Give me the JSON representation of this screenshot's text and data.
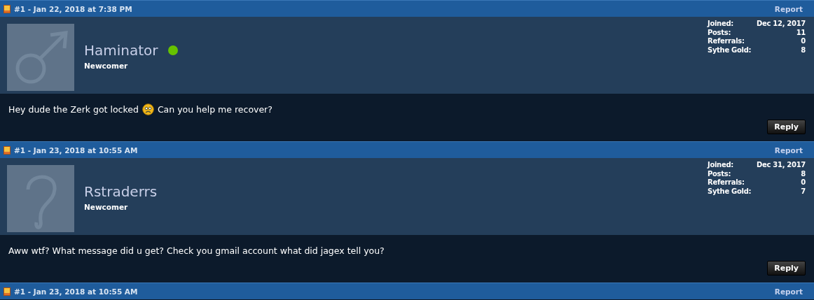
{
  "posts": [
    {
      "header": "#1 - Jan 22, 2018 at 7:38 PM",
      "report": "Report",
      "user": {
        "name": "Haminator",
        "online": true,
        "rank": "Newcomer",
        "avatar": {
          "kind": "male"
        }
      },
      "stats": [
        {
          "label": "Joined:",
          "value": "Dec 12, 2017"
        },
        {
          "label": "Posts:",
          "value": "11"
        },
        {
          "label": "Referrals:",
          "value": "0"
        },
        {
          "label": "Sythe Gold:",
          "value": "8"
        }
      ],
      "message": [
        "Hey dude the Zerk got locked",
        "Can you help me recover?"
      ],
      "reply": "Reply"
    },
    {
      "header": "#1 - Jan 23, 2018 at 10:55 AM",
      "report": "Report",
      "user": {
        "name": "Rstraderrs",
        "online": false,
        "rank": "Newcomer",
        "avatar": {
          "kind": "question"
        }
      },
      "stats": [
        {
          "label": "Joined:",
          "value": "Dec 31, 2017"
        },
        {
          "label": "Posts:",
          "value": "8"
        },
        {
          "label": "Referrals:",
          "value": "0"
        },
        {
          "label": "Sythe Gold:",
          "value": "7"
        }
      ],
      "message": [
        "Aww wtf? What message did u get? Check you gmail account what did jagex tell you?"
      ],
      "reply": "Reply"
    },
    {
      "header": "#1 - Jan 23, 2018 at 10:55 AM",
      "report": "Report"
    }
  ]
}
